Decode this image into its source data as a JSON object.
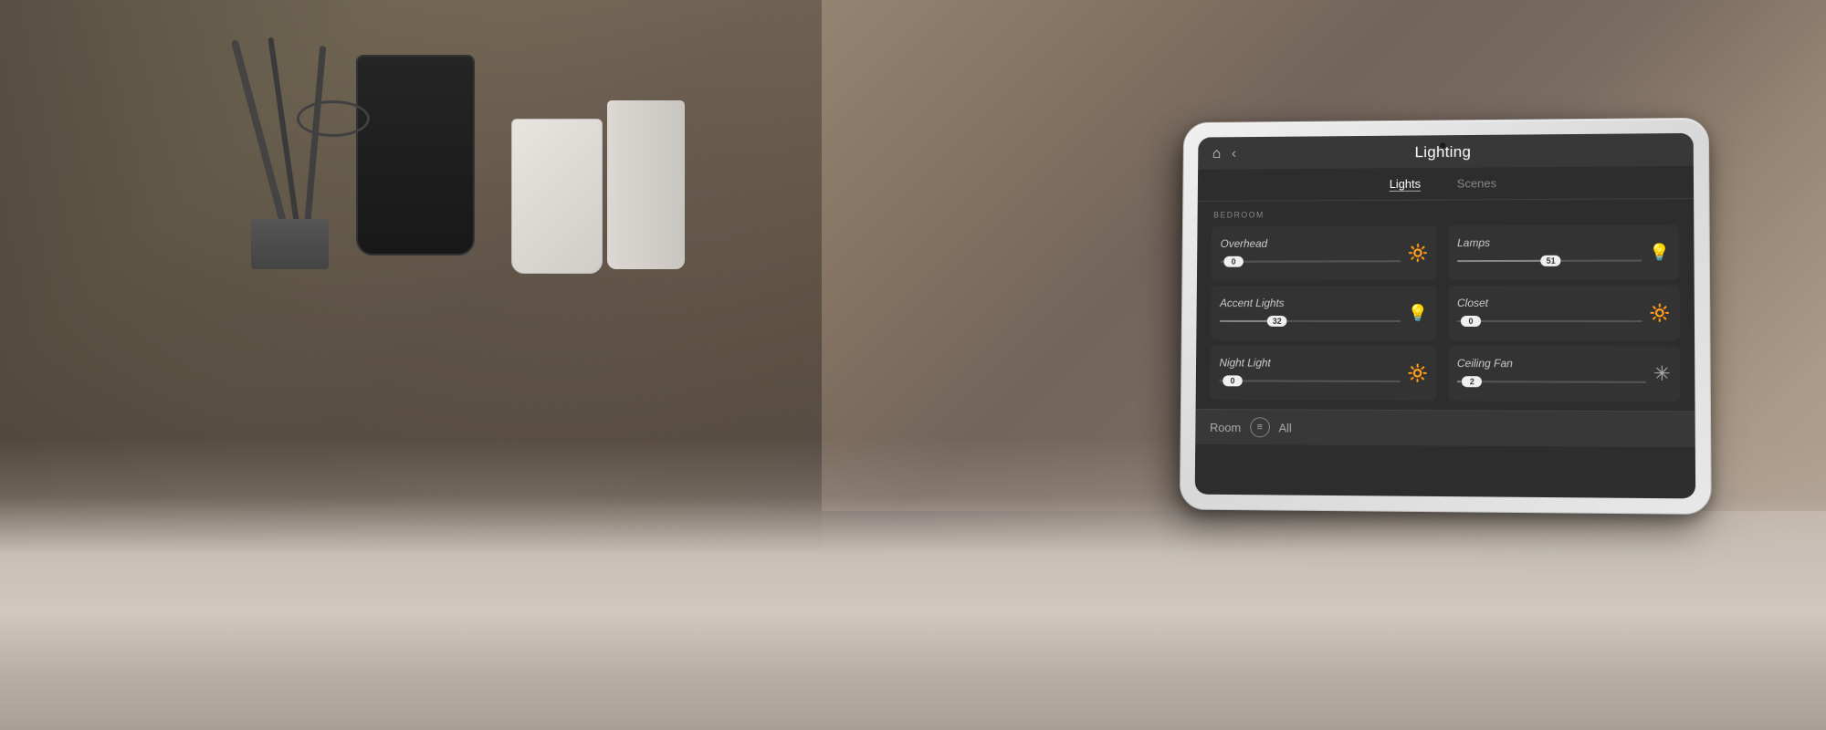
{
  "background": {
    "description": "Kitchen countertop scene"
  },
  "header": {
    "title": "Lighting",
    "home_icon": "⌂",
    "back_icon": "‹"
  },
  "tabs": [
    {
      "id": "lights",
      "label": "Lights",
      "active": true
    },
    {
      "id": "scenes",
      "label": "Scenes",
      "active": false
    }
  ],
  "section": {
    "label": "BEDROOM"
  },
  "controls": [
    {
      "id": "overhead",
      "name": "Overhead",
      "value": 0,
      "fill_pct": 0,
      "icon": "💡",
      "icon_dim": true,
      "col": "left"
    },
    {
      "id": "lamps",
      "name": "Lamps",
      "value": 51,
      "fill_pct": 51,
      "icon": "💡",
      "icon_dim": false,
      "col": "right"
    },
    {
      "id": "accent-lights",
      "name": "Accent Lights",
      "value": 32,
      "fill_pct": 32,
      "icon": "💡",
      "icon_dim": false,
      "col": "left"
    },
    {
      "id": "closet",
      "name": "Closet",
      "value": 0,
      "fill_pct": 0,
      "icon": "💡",
      "icon_dim": true,
      "col": "right"
    },
    {
      "id": "night-light",
      "name": "Night Light",
      "value": 0,
      "fill_pct": 0,
      "icon": "💡",
      "icon_dim": true,
      "col": "left"
    },
    {
      "id": "ceiling-fan",
      "name": "Ceiling Fan",
      "value": 2,
      "fill_pct": 2,
      "icon": "✳",
      "is_fan": true,
      "col": "right"
    }
  ],
  "footer": {
    "room_label": "Room",
    "menu_icon": "≡",
    "all_label": "All"
  }
}
